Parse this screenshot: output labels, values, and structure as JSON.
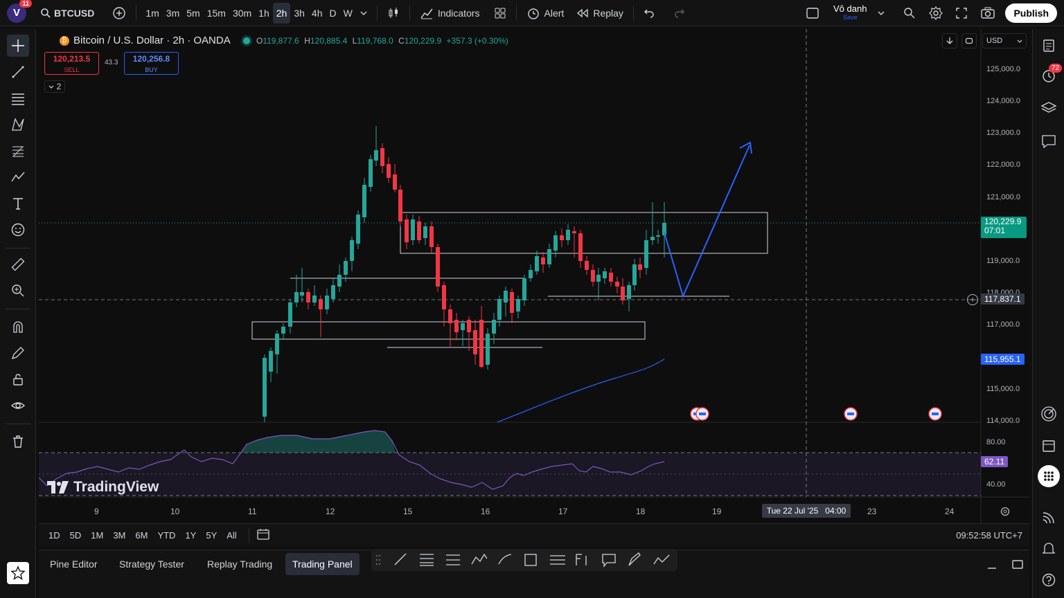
{
  "topbar": {
    "avatar_letter": "V",
    "avatar_badge": "11",
    "symbol": "BTCUSD",
    "timeframes": [
      "1m",
      "3m",
      "5m",
      "15m",
      "30m",
      "1h",
      "2h",
      "3h",
      "4h",
      "D",
      "W"
    ],
    "active_timeframe": "2h",
    "indicators_label": "Indicators",
    "alert_label": "Alert",
    "replay_label": "Replay",
    "layout_name": "Vô danh",
    "layout_save": "Save",
    "publish_label": "Publish"
  },
  "legend": {
    "title": "Bitcoin / U.S. Dollar · 2h · OANDA",
    "o_label": "O",
    "o": "119,877.6",
    "h_label": "H",
    "h": "120,885.4",
    "l_label": "L",
    "l": "119,768.0",
    "c_label": "C",
    "c": "120,229.9",
    "change": "+357.3 (+0.30%)",
    "sell_price": "120,213.5",
    "sell_label": "SELL",
    "spread": "43.3",
    "buy_price": "120,256.8",
    "buy_label": "BUY",
    "collapse_count": "2"
  },
  "price_axis": {
    "currency": "USD",
    "ticks": [
      "125,000.0",
      "124,000.0",
      "123,000.0",
      "122,000.0",
      "121,000.0",
      "119,000.0",
      "118,000.0",
      "117,000.0",
      "115,000.0",
      "114,000.0"
    ],
    "current_price": "120,229.9",
    "countdown": "07:01",
    "crosshair_price": "117,837.1",
    "ma_price": "115,955.1",
    "rsi_ticks": [
      "80.00",
      "40.00"
    ],
    "rsi_value": "62.11"
  },
  "time_axis": {
    "ticks": [
      "9",
      "10",
      "11",
      "12",
      "15",
      "16",
      "17",
      "18",
      "19",
      "23",
      "24"
    ],
    "crosshair_label": "Tue 22 Jul '25",
    "crosshair_time": "04:00"
  },
  "range_bar": {
    "ranges": [
      "1D",
      "5D",
      "1M",
      "3M",
      "6M",
      "YTD",
      "1Y",
      "5Y",
      "All"
    ],
    "clock": "09:52:58 UTC+7"
  },
  "bottom_tabs": [
    "Pine Editor",
    "Strategy Tester",
    "Replay Trading",
    "Trading Panel"
  ],
  "active_bottom_tab": "Trading Panel",
  "logo_text": "TradingView",
  "notifications_badge": "72",
  "colors": {
    "up": "#26a69a",
    "down": "#f23645",
    "projection": "#2962ff",
    "rsi": "#7e57c2"
  }
}
